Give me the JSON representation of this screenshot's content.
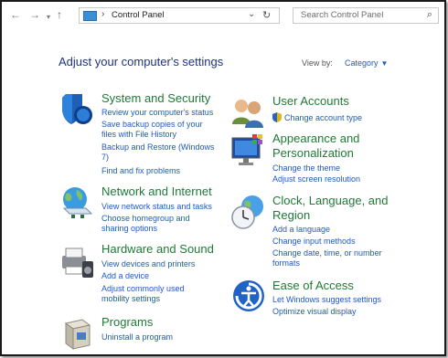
{
  "toolbar": {
    "back_glyph": "←",
    "forward_glyph": "→",
    "recent_glyph": "▾",
    "up_glyph": "↑",
    "breadcrumb_sep": "›",
    "breadcrumb": "Control Panel",
    "address_dropdown_glyph": "⌄",
    "refresh_glyph": "↻",
    "search_placeholder": "Search Control Panel",
    "search_glyph": "⌕"
  },
  "header": {
    "title": "Adjust your computer's settings",
    "view_by_label": "View by:",
    "view_by_value": "Category",
    "view_by_caret": "▼"
  },
  "categories": {
    "system": {
      "title": "System and Security",
      "links": [
        "Review your computer's status",
        "Save backup copies of your",
        "files with File History",
        "Backup and Restore (Windows",
        "7)",
        "Find and fix problems"
      ]
    },
    "network": {
      "title": "Network and Internet",
      "links": [
        "View network status and tasks",
        "Choose homegroup and",
        "sharing options"
      ]
    },
    "hardware": {
      "title": "Hardware and Sound",
      "links": [
        "View devices and printers",
        "Add a device",
        "Adjust commonly used",
        "mobility settings"
      ]
    },
    "programs": {
      "title": "Programs",
      "links": [
        "Uninstall a program"
      ]
    },
    "users": {
      "title": "User Accounts",
      "links": [
        "Change account type"
      ]
    },
    "appearance": {
      "title_lines": [
        "Appearance and",
        "Personalization"
      ],
      "links": [
        "Change the theme",
        "Adjust screen resolution"
      ]
    },
    "clock": {
      "title_lines": [
        "Clock, Language, and",
        "Region"
      ],
      "links": [
        "Add a language",
        "Change input methods",
        "Change date, time, or number",
        "formats"
      ]
    },
    "ease": {
      "title": "Ease of Access",
      "links": [
        "Let Windows suggest settings",
        "Optimize visual display"
      ]
    }
  },
  "colors": {
    "category_title": "#1f7a36",
    "link": "#1e5bbf",
    "heading": "#1e3287"
  }
}
